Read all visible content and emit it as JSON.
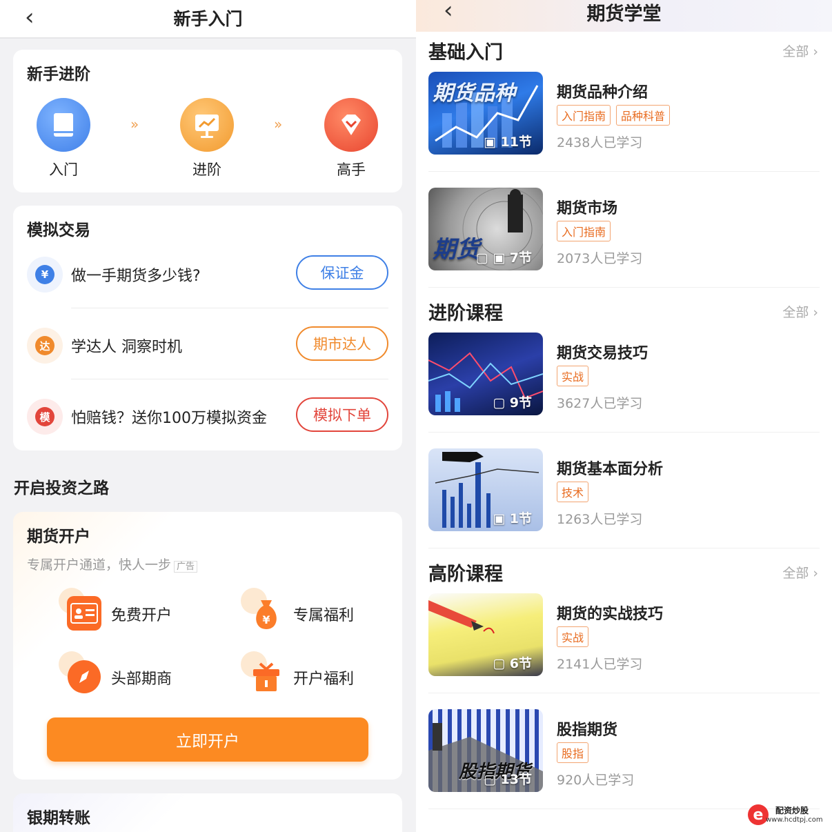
{
  "left": {
    "nav": {
      "title": "新手入门"
    },
    "stages": {
      "title": "新手进阶",
      "arrow": "»",
      "items": [
        {
          "label": "入门",
          "icon": "book-icon",
          "color": "#4a8ff0"
        },
        {
          "label": "进阶",
          "icon": "presentation-icon",
          "color": "#f2a33a"
        },
        {
          "label": "高手",
          "icon": "diamond-icon",
          "color": "#ee5a3c"
        }
      ]
    },
    "simulate": {
      "title": "模拟交易",
      "rows": [
        {
          "icon_text": "¥",
          "icon": "yuan-icon",
          "text": "做一手期货多少钱?",
          "button": "保证金",
          "color": "#3f80e6"
        },
        {
          "icon_text": "达",
          "icon": "expert-icon",
          "text": "学达人 洞察时机",
          "button": "期市达人",
          "color": "#f08a2c"
        },
        {
          "icon_text": "模",
          "icon": "simulate-icon",
          "text": "怕赔钱？送你100万模拟资金",
          "button": "模拟下单",
          "color": "#e2453b"
        }
      ]
    },
    "invest_heading": "开启投资之路",
    "account": {
      "title": "期货开户",
      "subtitle": "专属开户通道，快人一步",
      "ad": "广告",
      "features": [
        {
          "label": "免费开户",
          "icon": "id-card-icon"
        },
        {
          "label": "专属福利",
          "icon": "money-bag-icon"
        },
        {
          "label": "头部期商",
          "icon": "compass-icon"
        },
        {
          "label": "开户福利",
          "icon": "gift-icon"
        }
      ],
      "button": "立即开户"
    },
    "bank": {
      "title": "银期转账"
    }
  },
  "right": {
    "nav": {
      "title": "期货学堂"
    },
    "all_label": "全部",
    "sections": [
      {
        "title": "基础入门",
        "courses": [
          {
            "title": "期货品种介绍",
            "tags": [
              "入门指南",
              "品种科普"
            ],
            "learners": "2438人已学习",
            "count": "11节",
            "cover": "期货品种"
          },
          {
            "title": "期货市场",
            "tags": [
              "入门指南"
            ],
            "learners": "2073人已学习",
            "count": "7节",
            "cover": "期货"
          }
        ]
      },
      {
        "title": "进阶课程",
        "courses": [
          {
            "title": "期货交易技巧",
            "tags": [
              "实战"
            ],
            "learners": "3627人已学习",
            "count": "9节",
            "cover": ""
          },
          {
            "title": "期货基本面分析",
            "tags": [
              "技术"
            ],
            "learners": "1263人已学习",
            "count": "1节",
            "cover": ""
          }
        ]
      },
      {
        "title": "高阶课程",
        "courses": [
          {
            "title": "期货的实战技巧",
            "tags": [
              "实战"
            ],
            "learners": "2141人已学习",
            "count": "6节",
            "cover": ""
          },
          {
            "title": "股指期货",
            "tags": [
              "股指"
            ],
            "learners": "920人已学习",
            "count": "13节",
            "cover": "股指期货"
          }
        ]
      }
    ],
    "watermark": {
      "line1": "配资炒股",
      "line2": "www.hcdtpj.com",
      "logo": "e"
    }
  }
}
